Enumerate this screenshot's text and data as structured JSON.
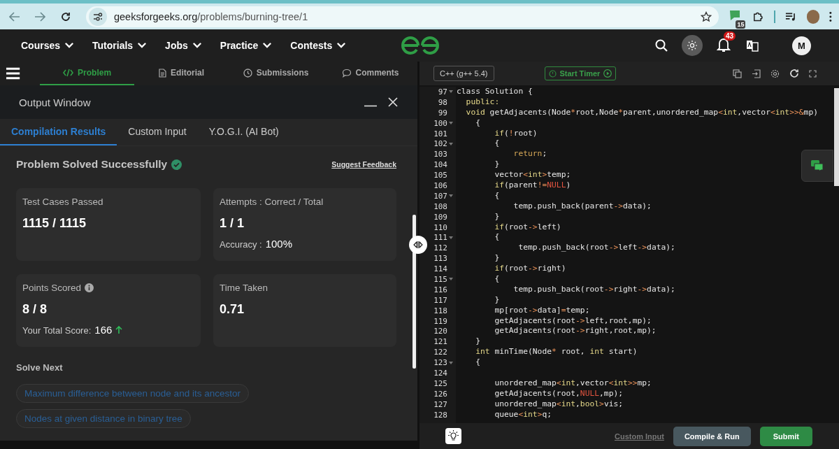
{
  "browser": {
    "url_domain": "geeksforgeeks.org",
    "url_path": "/problems/burning-tree/1",
    "extension_badge": "15"
  },
  "nav": {
    "items": [
      {
        "label": "Courses"
      },
      {
        "label": "Tutorials"
      },
      {
        "label": "Jobs"
      },
      {
        "label": "Practice"
      },
      {
        "label": "Contests"
      }
    ],
    "notifications": "43",
    "avatar": "M"
  },
  "problem_tabs": [
    {
      "label": "Problem",
      "kind": "code",
      "selected": true
    },
    {
      "label": "Editorial",
      "kind": "doc",
      "selected": false
    },
    {
      "label": "Submissions",
      "kind": "clock",
      "selected": false
    },
    {
      "label": "Comments",
      "kind": "chat",
      "selected": false
    }
  ],
  "output_window": {
    "title": "Output Window",
    "tabs": [
      {
        "label": "Compilation Results",
        "selected": true
      },
      {
        "label": "Custom Input",
        "selected": false
      },
      {
        "label": "Y.O.G.I. (AI Bot)",
        "selected": false
      }
    ],
    "status": "Problem Solved Successfully",
    "feedback_link": "Suggest Feedback",
    "cards": [
      {
        "label": "Test Cases Passed",
        "value": "1115 / 1115"
      },
      {
        "label": "Attempts : Correct / Total",
        "value": "1 / 1",
        "sub_label": "Accuracy :",
        "sub_value": "100%"
      },
      {
        "label": "Points Scored",
        "info": true,
        "value": "8 / 8",
        "sub_label": "Your Total Score:",
        "sub_value": "166",
        "trend_up": true
      },
      {
        "label": "Time Taken",
        "value": "0.71"
      }
    ],
    "solve_next_title": "Solve Next",
    "solve_next": [
      "Maximum difference between node and its ancestor",
      "Nodes at given distance in binary tree"
    ]
  },
  "editor": {
    "language": "C++ (g++ 5.4)",
    "timer_button": "Start Timer",
    "lines": [
      {
        "number": "97",
        "fold": true,
        "tokens": [
          {
            "text": "class Solution {",
            "kind": "plain"
          }
        ]
      },
      {
        "number": "98",
        "fold": false,
        "tokens": [
          {
            "text": "  public:",
            "kind": "keyword"
          }
        ]
      },
      {
        "number": "99",
        "fold": false,
        "tokens": [
          {
            "text": "  void",
            "kind": "keyword"
          },
          {
            "text": " getAdjacents(Node",
            "kind": "plain"
          },
          {
            "text": "*",
            "kind": "operator"
          },
          {
            "text": "root,Node",
            "kind": "plain"
          },
          {
            "text": "*",
            "kind": "operator"
          },
          {
            "text": "parent,unordered_map",
            "kind": "plain"
          },
          {
            "text": "<",
            "kind": "operator"
          },
          {
            "text": "int",
            "kind": "keyword"
          },
          {
            "text": ",vector",
            "kind": "plain"
          },
          {
            "text": "<",
            "kind": "operator"
          },
          {
            "text": "int",
            "kind": "keyword"
          },
          {
            "text": ">>&",
            "kind": "operator"
          },
          {
            "text": "mp)",
            "kind": "plain"
          }
        ]
      },
      {
        "number": "100",
        "fold": true,
        "tokens": [
          {
            "text": "    {",
            "kind": "plain"
          }
        ]
      },
      {
        "number": "101",
        "fold": false,
        "tokens": [
          {
            "text": "        if",
            "kind": "keyword"
          },
          {
            "text": "(",
            "kind": "plain"
          },
          {
            "text": "!",
            "kind": "operator"
          },
          {
            "text": "root)",
            "kind": "plain"
          }
        ]
      },
      {
        "number": "102",
        "fold": true,
        "tokens": [
          {
            "text": "        {",
            "kind": "plain"
          }
        ]
      },
      {
        "number": "103",
        "fold": false,
        "tokens": [
          {
            "text": "            return",
            "kind": "return"
          },
          {
            "text": ";",
            "kind": "plain"
          }
        ]
      },
      {
        "number": "104",
        "fold": false,
        "tokens": [
          {
            "text": "        }",
            "kind": "plain"
          }
        ]
      },
      {
        "number": "105",
        "fold": false,
        "tokens": [
          {
            "text": "        vector",
            "kind": "plain"
          },
          {
            "text": "<",
            "kind": "operator"
          },
          {
            "text": "int",
            "kind": "keyword"
          },
          {
            "text": ">",
            "kind": "operator"
          },
          {
            "text": "temp;",
            "kind": "plain"
          }
        ]
      },
      {
        "number": "106",
        "fold": false,
        "tokens": [
          {
            "text": "        if",
            "kind": "keyword"
          },
          {
            "text": "(parent",
            "kind": "plain"
          },
          {
            "text": "!=",
            "kind": "operator"
          },
          {
            "text": "NULL",
            "kind": "constant"
          },
          {
            "text": ")",
            "kind": "plain"
          }
        ]
      },
      {
        "number": "107",
        "fold": true,
        "tokens": [
          {
            "text": "        {",
            "kind": "plain"
          }
        ]
      },
      {
        "number": "108",
        "fold": false,
        "tokens": [
          {
            "text": "            temp.push_back(parent",
            "kind": "plain"
          },
          {
            "text": "->",
            "kind": "operator"
          },
          {
            "text": "data);",
            "kind": "plain"
          }
        ]
      },
      {
        "number": "109",
        "fold": false,
        "tokens": [
          {
            "text": "        }",
            "kind": "plain"
          }
        ]
      },
      {
        "number": "110",
        "fold": false,
        "tokens": [
          {
            "text": "        if",
            "kind": "keyword"
          },
          {
            "text": "(root",
            "kind": "plain"
          },
          {
            "text": "->",
            "kind": "operator"
          },
          {
            "text": "left)",
            "kind": "plain"
          }
        ]
      },
      {
        "number": "111",
        "fold": true,
        "tokens": [
          {
            "text": "        {",
            "kind": "plain"
          }
        ]
      },
      {
        "number": "112",
        "fold": false,
        "tokens": [
          {
            "text": "             temp.push_back(root",
            "kind": "plain"
          },
          {
            "text": "->",
            "kind": "operator"
          },
          {
            "text": "left",
            "kind": "plain"
          },
          {
            "text": "->",
            "kind": "operator"
          },
          {
            "text": "data);",
            "kind": "plain"
          }
        ]
      },
      {
        "number": "113",
        "fold": false,
        "tokens": [
          {
            "text": "        }",
            "kind": "plain"
          }
        ]
      },
      {
        "number": "114",
        "fold": false,
        "tokens": [
          {
            "text": "        if",
            "kind": "keyword"
          },
          {
            "text": "(root",
            "kind": "plain"
          },
          {
            "text": "->",
            "kind": "operator"
          },
          {
            "text": "right)",
            "kind": "plain"
          }
        ]
      },
      {
        "number": "115",
        "fold": true,
        "tokens": [
          {
            "text": "        {",
            "kind": "plain"
          }
        ]
      },
      {
        "number": "116",
        "fold": false,
        "tokens": [
          {
            "text": "            temp.push_back(root",
            "kind": "plain"
          },
          {
            "text": "->",
            "kind": "operator"
          },
          {
            "text": "right",
            "kind": "plain"
          },
          {
            "text": "->",
            "kind": "operator"
          },
          {
            "text": "data);",
            "kind": "plain"
          }
        ]
      },
      {
        "number": "117",
        "fold": false,
        "tokens": [
          {
            "text": "        }",
            "kind": "plain"
          }
        ]
      },
      {
        "number": "118",
        "fold": false,
        "tokens": [
          {
            "text": "        mp[root",
            "kind": "plain"
          },
          {
            "text": "->",
            "kind": "operator"
          },
          {
            "text": "data]",
            "kind": "plain"
          },
          {
            "text": "=",
            "kind": "operator"
          },
          {
            "text": "temp;",
            "kind": "plain"
          }
        ]
      },
      {
        "number": "119",
        "fold": false,
        "tokens": [
          {
            "text": "        getAdjacents(root",
            "kind": "plain"
          },
          {
            "text": "->",
            "kind": "operator"
          },
          {
            "text": "left,root,mp);",
            "kind": "plain"
          }
        ]
      },
      {
        "number": "120",
        "fold": false,
        "tokens": [
          {
            "text": "        getAdjacents(root",
            "kind": "plain"
          },
          {
            "text": "->",
            "kind": "operator"
          },
          {
            "text": "right,root,mp);",
            "kind": "plain"
          }
        ]
      },
      {
        "number": "121",
        "fold": false,
        "tokens": [
          {
            "text": "    }",
            "kind": "plain"
          }
        ]
      },
      {
        "number": "122",
        "fold": false,
        "tokens": [
          {
            "text": "    int",
            "kind": "keyword"
          },
          {
            "text": " minTime(Node",
            "kind": "plain"
          },
          {
            "text": "*",
            "kind": "operator"
          },
          {
            "text": " root, ",
            "kind": "plain"
          },
          {
            "text": "int",
            "kind": "keyword"
          },
          {
            "text": " start)",
            "kind": "plain"
          }
        ]
      },
      {
        "number": "123",
        "fold": true,
        "tokens": [
          {
            "text": "    {",
            "kind": "plain"
          }
        ]
      },
      {
        "number": "124",
        "fold": false
      },
      {
        "number": "125",
        "fold": false,
        "tokens": [
          {
            "text": "        unordered_map",
            "kind": "plain"
          },
          {
            "text": "<",
            "kind": "operator"
          },
          {
            "text": "int",
            "kind": "keyword"
          },
          {
            "text": ",vector",
            "kind": "plain"
          },
          {
            "text": "<",
            "kind": "operator"
          },
          {
            "text": "int",
            "kind": "keyword"
          },
          {
            "text": ">>",
            "kind": "operator"
          },
          {
            "text": "mp;",
            "kind": "plain"
          }
        ]
      },
      {
        "number": "126",
        "fold": false,
        "tokens": [
          {
            "text": "        getAdjacents(root,",
            "kind": "plain"
          },
          {
            "text": "NULL",
            "kind": "constant"
          },
          {
            "text": ",mp);",
            "kind": "plain"
          }
        ]
      },
      {
        "number": "127",
        "fold": false,
        "tokens": [
          {
            "text": "        unordered_map",
            "kind": "plain"
          },
          {
            "text": "<",
            "kind": "operator"
          },
          {
            "text": "int",
            "kind": "keyword"
          },
          {
            "text": ",",
            "kind": "plain"
          },
          {
            "text": "bool",
            "kind": "keyword"
          },
          {
            "text": ">",
            "kind": "operator"
          },
          {
            "text": "vis;",
            "kind": "plain"
          }
        ]
      },
      {
        "number": "128",
        "fold": false,
        "tokens": [
          {
            "text": "        queue",
            "kind": "plain"
          },
          {
            "text": "<",
            "kind": "operator"
          },
          {
            "text": "int",
            "kind": "keyword"
          },
          {
            "text": ">",
            "kind": "operator"
          },
          {
            "text": "q;",
            "kind": "plain"
          }
        ]
      }
    ],
    "custom_input_link": "Custom Input",
    "compile_button": "Compile & Run",
    "submit_button": "Submit"
  }
}
